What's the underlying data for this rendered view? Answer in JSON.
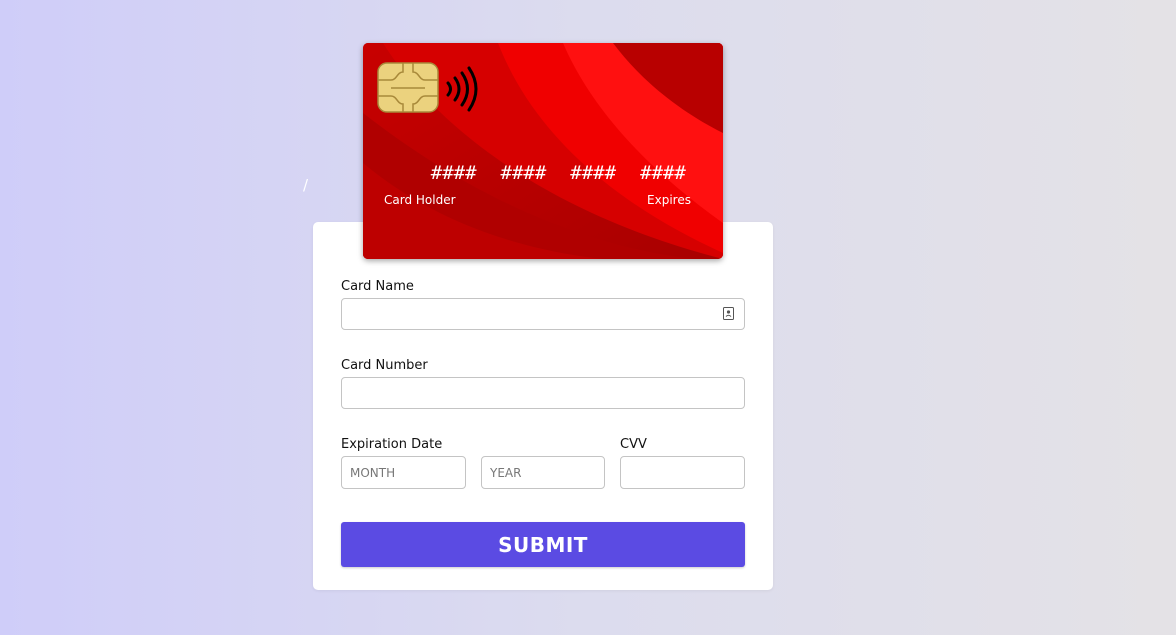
{
  "card_preview": {
    "number_groups": [
      "####",
      "####",
      "####",
      "####"
    ],
    "holder_label": "Card Holder",
    "expires_label": "Expires",
    "expires_value": "/"
  },
  "form": {
    "card_name_label": "Card Name",
    "card_name_value": "",
    "card_number_label": "Card Number",
    "card_number_value": "",
    "expiration_label": "Expiration Date",
    "month_placeholder": "MONTH",
    "year_placeholder": "YEAR",
    "cvv_label": "CVV",
    "cvv_value": "",
    "submit_label": "SUBMIT"
  },
  "icons": {
    "chip": "card-chip-icon",
    "contactless": "contactless-icon",
    "autofill": "contact-card-autofill-icon"
  },
  "colors": {
    "card_red": "#d40000",
    "accent": "#5b4be3"
  }
}
